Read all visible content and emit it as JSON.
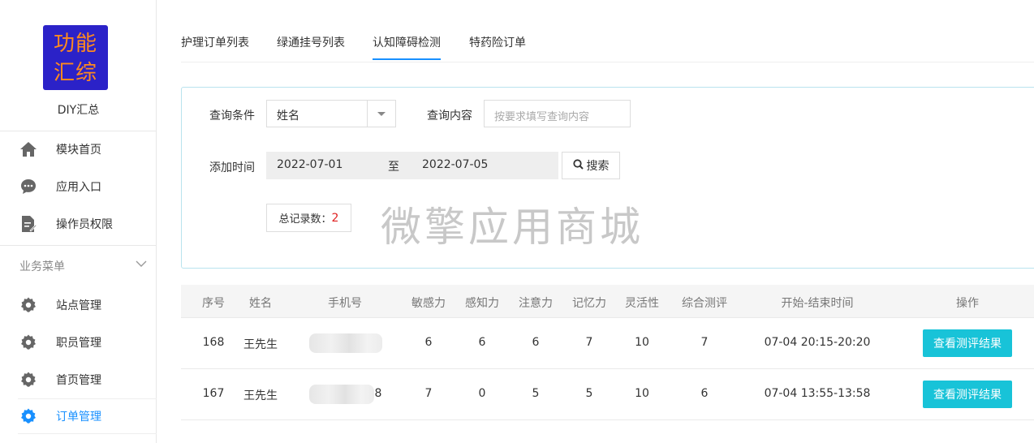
{
  "app": {
    "logo_line1": "功能",
    "logo_line2": "汇综",
    "name": "DIY汇总"
  },
  "sidebar": {
    "top_items": [
      {
        "label": "模块首页",
        "icon": "home-icon"
      },
      {
        "label": "应用入口",
        "icon": "chat-icon"
      },
      {
        "label": "操作员权限",
        "icon": "edit-doc-icon"
      }
    ],
    "group_title": "业务菜单",
    "group_items": [
      {
        "label": "站点管理",
        "icon": "gear-icon"
      },
      {
        "label": "职员管理",
        "icon": "gear-icon"
      },
      {
        "label": "首页管理",
        "icon": "gear-icon"
      },
      {
        "label": "订单管理",
        "icon": "gear-icon",
        "active": true
      }
    ]
  },
  "tabs": [
    {
      "label": "护理订单列表"
    },
    {
      "label": "绿通挂号列表"
    },
    {
      "label": "认知障碍检测",
      "active": true
    },
    {
      "label": "特药险订单"
    }
  ],
  "filter": {
    "condition_label": "查询条件",
    "condition_value": "姓名",
    "content_label": "查询内容",
    "content_placeholder": "按要求填写查询内容",
    "time_label": "添加时间",
    "date_from": "2022-07-01",
    "date_sep": "至",
    "date_to": "2022-07-05",
    "search_label": "搜索",
    "total_label": "总记录数：",
    "total_value": "2"
  },
  "watermark": "微擎应用商城",
  "table": {
    "headers": [
      "序号",
      "姓名",
      "手机号",
      "敏感力",
      "感知力",
      "注意力",
      "记忆力",
      "灵活性",
      "综合测评",
      "开始-结束时间",
      "操作"
    ],
    "rows": [
      {
        "id": "168",
        "name": "王先生",
        "phone_visible": "",
        "c1": "6",
        "c2": "6",
        "c3": "6",
        "c4": "7",
        "c5": "10",
        "c6": "7",
        "time": "07-04 20:15-20:20",
        "action": "查看测评结果"
      },
      {
        "id": "167",
        "name": "王先生",
        "phone_visible": "8",
        "c1": "7",
        "c2": "0",
        "c3": "5",
        "c4": "5",
        "c5": "10",
        "c6": "6",
        "time": "07-04 13:55-13:58",
        "action": "查看测评结果"
      }
    ]
  },
  "colors": {
    "accent": "#1890ff",
    "logo_bg": "#2b22c8",
    "logo_text": "#ff8a1e",
    "action_btn": "#18c3d8",
    "total_num": "#e02020"
  }
}
